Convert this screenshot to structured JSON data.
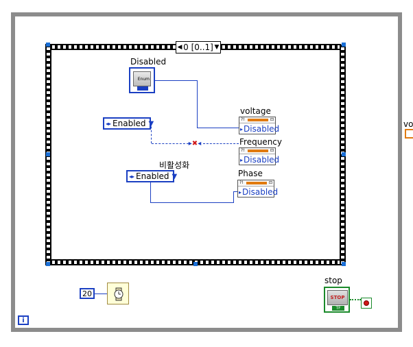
{
  "sequence": {
    "selector_label": "0 [0..1]"
  },
  "enum_constant": {
    "label": "Disabled",
    "face_text": "Enum"
  },
  "ring_enabled_top": {
    "value": "Enabled"
  },
  "ring_enabled_bottom": {
    "label": "비활성화",
    "value": "Enabled"
  },
  "property_nodes": [
    {
      "label": "voltage",
      "value": "Disabled"
    },
    {
      "label": "Frequency",
      "value": "Disabled"
    },
    {
      "label": "Phase",
      "value": "Disabled"
    }
  ],
  "wait": {
    "ms_value": "20"
  },
  "stop": {
    "label": "stop",
    "button_text": "STOP",
    "tf_text": "TF"
  },
  "iteration": {
    "symbol": "i"
  },
  "edge": {
    "label_fragment": "vo"
  },
  "colors": {
    "wire_blue": "#1a3fc2",
    "loop_gray": "#8c8c8c",
    "orange": "#e07a10",
    "bool_green": "#1a8a2a",
    "handle_blue": "#1a6fd6"
  }
}
